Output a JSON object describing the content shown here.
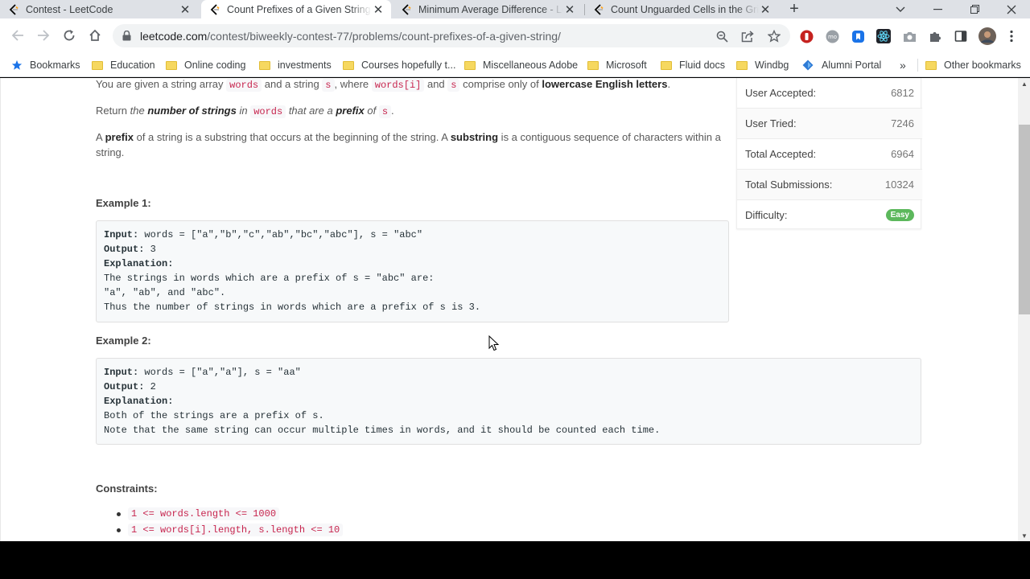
{
  "tabs": [
    {
      "title": "Contest - LeetCode",
      "close": "✕"
    },
    {
      "title": "Count Prefixes of a Given String - LeetCode",
      "close": "✕"
    },
    {
      "title": "Minimum Average Difference - LeetCode",
      "close": "✕"
    },
    {
      "title": "Count Unguarded Cells in the Grid - LeetCode",
      "close": "✕"
    }
  ],
  "new_tab": "+",
  "address": {
    "host": "leetcode.com",
    "path": "/contest/biweekly-contest-77/problems/count-prefixes-of-a-given-string/"
  },
  "bookmarks": {
    "main": "Bookmarks",
    "folders": [
      "Education",
      "Online coding",
      "investments",
      "Courses hopefully t...",
      "Miscellaneous Adobe",
      "Microsoft",
      "Fluid docs",
      "Windbg"
    ],
    "alumni": "Alumni Portal",
    "overflow": "»",
    "other": "Other bookmarks"
  },
  "problem": {
    "p1": {
      "t1": "You are given a string array ",
      "c1": "words",
      "t2": " and a string ",
      "c2": "s",
      "t3": ", where ",
      "c3": "words[i]",
      "t4": " and ",
      "c4": "s",
      "t5": " comprise only of ",
      "b1": "lowercase English letters",
      "t6": "."
    },
    "p2": {
      "t1": "Return ",
      "i1": "the ",
      "b1": "number of strings",
      "i2": " in ",
      "c1": "words",
      "i3": " that are a ",
      "b2": "prefix",
      "i4": " of ",
      "c2": "s",
      "t2": "."
    },
    "p3": {
      "t1": "A ",
      "b1": "prefix",
      "t2": " of a string is a substring that occurs at the beginning of the string. A ",
      "b2": "substring",
      "t3": " is a contiguous sequence of characters within a",
      "line2": "string."
    },
    "example1": {
      "heading": "Example 1:",
      "input_label": "Input:",
      "input": " words = [\"a\",\"b\",\"c\",\"ab\",\"bc\",\"abc\"], s = \"abc\"",
      "output_label": "Output:",
      "output": " 3",
      "explanation_label": "Explanation:",
      "lines": [
        "The strings in words which are a prefix of s = \"abc\" are:",
        "\"a\", \"ab\", and \"abc\".",
        "Thus the number of strings in words which are a prefix of s is 3."
      ]
    },
    "example2": {
      "heading": "Example 2:",
      "input_label": "Input:",
      "input": " words = [\"a\",\"a\"], s = \"aa\"",
      "output_label": "Output:",
      "output": " 2",
      "explanation_label": "Explanation:",
      "lines": [
        "Both of the strings are a prefix of s.",
        "Note that the same string can occur multiple times in words, and it should be counted each time."
      ]
    },
    "constraints_heading": "Constraints:",
    "constraints": [
      "1 <= words.length <= 1000",
      "1 <= words[i].length, s.length <= 10"
    ]
  },
  "stats": {
    "user_accepted": {
      "label": "User Accepted:",
      "value": "6812"
    },
    "user_tried": {
      "label": "User Tried:",
      "value": "7246"
    },
    "total_accepted": {
      "label": "Total Accepted:",
      "value": "6964"
    },
    "total_submissions": {
      "label": "Total Submissions:",
      "value": "10324"
    },
    "difficulty": {
      "label": "Difficulty:",
      "value": "Easy"
    }
  },
  "colors": {
    "accent_easy": "#5cb85c",
    "inline_code": "#c7254e",
    "tabstrip": "#dee1e6"
  }
}
